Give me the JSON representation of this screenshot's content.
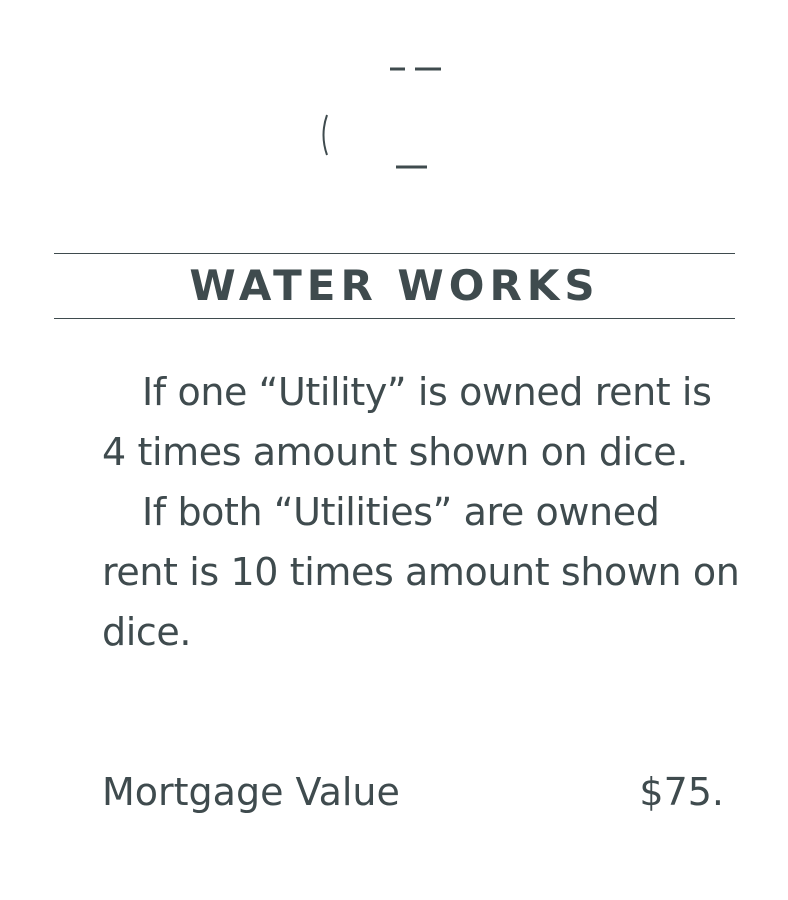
{
  "card": {
    "icon": "water-faucet-icon",
    "title": "WATER WORKS",
    "rule_paragraphs": [
      "If one “Utility” is owned rent is 4 times amount shown on dice.",
      "If both “Utilities” are owned rent is 10 times amount shown on dice."
    ],
    "mortgage_label": "Mortgage Value",
    "mortgage_value": "$75."
  },
  "colors": {
    "ink": "#3f4b4e",
    "background": "#ffffff"
  }
}
